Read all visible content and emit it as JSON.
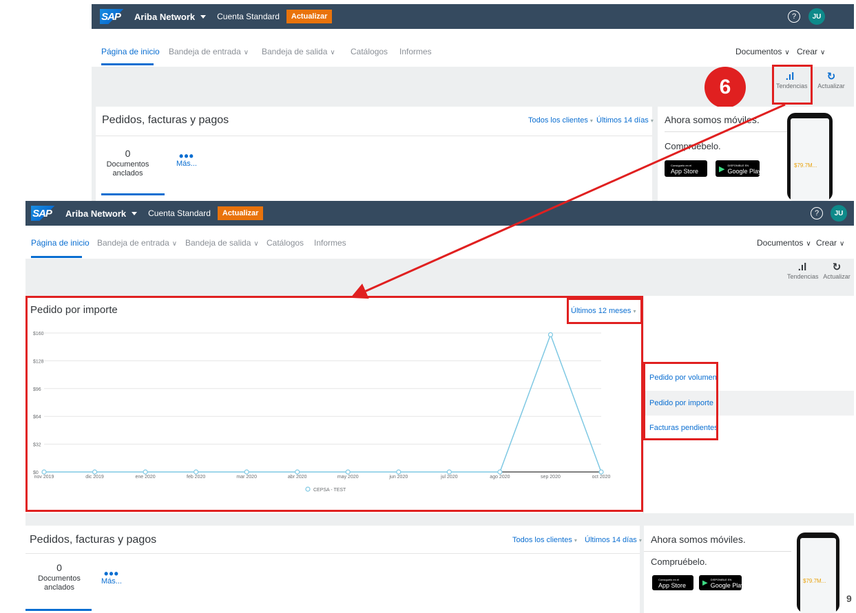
{
  "callout_number": "6",
  "page_number": "9",
  "top_screen": {
    "header": {
      "logo": "SAP",
      "brand": "Ariba Network",
      "account": "Cuenta Standard",
      "upgrade": "Actualizar",
      "help": "?",
      "avatar": "JU"
    },
    "nav": {
      "home": "Página de inicio",
      "inbox": "Bandeja de entrada",
      "outbox": "Bandeja de salida",
      "catalogs": "Catálogos",
      "reports": "Informes",
      "documents": "Documentos",
      "create": "Crear"
    },
    "tools": {
      "trends": "Tendencias",
      "refresh": "Actualizar"
    },
    "orders_card": {
      "title": "Pedidos, facturas y pagos",
      "clients_filter": "Todos los clientes",
      "period_filter": "Últimos 14 días",
      "pinned_count": "0",
      "pinned_label": "Documentos anclados",
      "more": "Más..."
    },
    "mobile": {
      "title": "Ahora somos móviles.",
      "subtitle": "Compruébelo.",
      "app_store_small": "Consíguelo en el",
      "app_store": "App Store",
      "google_play_small": "DISPONIBLE EN",
      "google_play": "Google Play",
      "phone_stat": "$79.7M..."
    }
  },
  "bottom_screen": {
    "header": {
      "logo": "SAP",
      "brand": "Ariba Network",
      "account": "Cuenta Standard",
      "upgrade": "Actualizar",
      "help": "?",
      "avatar": "JU"
    },
    "nav": {
      "home": "Página de inicio",
      "inbox": "Bandeja de entrada",
      "outbox": "Bandeja de salida",
      "catalogs": "Catálogos",
      "reports": "Informes",
      "documents": "Documentos",
      "create": "Crear"
    },
    "tools": {
      "trends": "Tendencias",
      "refresh": "Actualizar"
    },
    "chart_panel": {
      "title": "Pedido por importe",
      "period": "Últimos 12 meses",
      "side_links": [
        "Pedido por volumen",
        "Pedido por importe",
        "Facturas pendientes"
      ]
    },
    "orders_card": {
      "title": "Pedidos, facturas y pagos",
      "clients_filter": "Todos los clientes",
      "period_filter": "Últimos 14 días",
      "pinned_count": "0",
      "pinned_label": "Documentos anclados",
      "more": "Más..."
    },
    "mobile": {
      "title": "Ahora somos móviles.",
      "subtitle": "Compruébelo.",
      "app_store_small": "Consíguelo en el",
      "app_store": "App Store",
      "google_play_small": "DISPONIBLE EN",
      "google_play": "Google Play",
      "phone_stat": "$79.7M..."
    }
  },
  "chart_data": {
    "type": "line",
    "title": "",
    "categories": [
      "nov 2019",
      "dic 2019",
      "ene 2020",
      "feb 2020",
      "mar 2020",
      "abr 2020",
      "may 2020",
      "jun 2020",
      "jul 2020",
      "ago 2020",
      "sep 2020",
      "oct 2020"
    ],
    "series": [
      {
        "name": "CEPSA - TEST",
        "values": [
          0,
          0,
          0,
          0,
          0,
          0,
          0,
          0,
          0,
          0,
          158,
          0
        ]
      }
    ],
    "y_ticks": [
      "$0",
      "$32",
      "$64",
      "$96",
      "$128",
      "$160"
    ],
    "ylim": [
      0,
      160
    ],
    "grid": true,
    "legend": "bottom",
    "color": "#7ec8e3"
  }
}
